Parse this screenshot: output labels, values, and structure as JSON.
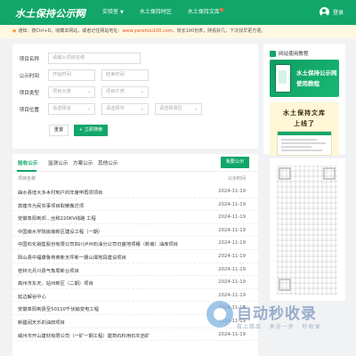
{
  "header": {
    "logo": "水土保持公示网",
    "nav": [
      {
        "label": "首页",
        "active": true,
        "caret": false,
        "dot": false
      },
      {
        "label": "实验室",
        "active": false,
        "caret": true,
        "dot": false
      },
      {
        "label": "水土保持时区",
        "active": false,
        "caret": false,
        "dot": false
      },
      {
        "label": "水土保持文库",
        "active": false,
        "caret": false,
        "dot": true
      }
    ],
    "login_label": "登录"
  },
  "notice": {
    "icon": "speaker-icon",
    "text_prefix": "通知：按Ctrl+D，收藏本网站，或者记住网站地址：",
    "url": "www.yanshou100.com",
    "text_suffix": "，较长100份表，随看好几，下次找早更方便。"
  },
  "search": {
    "rows": [
      {
        "label": "项目名称",
        "fields": [
          {
            "placeholder": "请输入项目名称",
            "select": false
          }
        ]
      },
      {
        "label": "公示时间",
        "fields": [
          {
            "placeholder": "开始时间",
            "select": false
          },
          {
            "placeholder": "结束时间",
            "select": false
          }
        ]
      },
      {
        "label": "项目类型",
        "fields": [
          {
            "placeholder": "项目大类",
            "select": true
          },
          {
            "placeholder": "项目子类",
            "select": true
          }
        ]
      },
      {
        "label": "项目位置",
        "fields": [
          {
            "placeholder": "请选择省",
            "select": true
          },
          {
            "placeholder": "请选择市",
            "select": true
          },
          {
            "placeholder": "请选择县区",
            "select": true
          }
        ]
      }
    ],
    "reset_label": "重置",
    "search_label": "立即搜索",
    "search_icon": "plus-icon"
  },
  "sidebar": {
    "tutorial_section_title": "网站使用教程",
    "tutorial_banner": {
      "line1": "水土保持公示网",
      "line2": "使用教程"
    },
    "library_banner": {
      "line1": "水土保持文库",
      "line2": "上线了"
    }
  },
  "list": {
    "tabs": [
      "验收公示",
      "监测公示",
      "方案公示",
      "其他公示"
    ],
    "active_tab": 0,
    "more_label": "我要公示",
    "col_name": "项目名称",
    "col_date": "公示时间",
    "rows": [
      {
        "name": "曲水县增大多木村到户的年度申再项项目",
        "date": "2024-11-19"
      },
      {
        "name": "敦煌市为民实事项目取暖搬迁项",
        "date": "2024-11-19"
      },
      {
        "name": "安徽阜阳到邓…丝和220KV线路 工程",
        "date": "2024-11-19"
      },
      {
        "name": "中国南水学院房南新区建设工程（一期）",
        "date": "2024-11-19"
      },
      {
        "name": "中国石化销售股份有限公司四川泸州石油分公司日盛地项桶（新南）油库项目",
        "date": "2024-11-19"
      },
      {
        "name": "阳山县中福康鲁商商新天坪新一期山潭地段建设项目",
        "date": "2024-11-19"
      },
      {
        "name": "桂林元月川县气象局新台项目",
        "date": "2024-11-19"
      },
      {
        "name": "高州市东天、站州新区（二期）项目",
        "date": "2024-11-19"
      },
      {
        "name": "延边解谷中心",
        "date": "2024-11-19"
      },
      {
        "name": "安徽阜阳到县至50110千伏输变电工程",
        "date": "2024-11-19"
      },
      {
        "name": "新疆阔天乐的油田项目",
        "date": "2024-11-19"
      },
      {
        "name": "威州市开山建材有限公司（一矿一期工程）建筑石料用石灰岩矿",
        "date": "2024-11-19"
      }
    ]
  },
  "watermark": {
    "text": "自动秒收录",
    "sub": "做上精品 · 来访一步 · 秒收录"
  },
  "colors": {
    "brand": "#11a66a",
    "notice_bg": "#fff8e1",
    "page_bg": "#f1f2f4"
  }
}
